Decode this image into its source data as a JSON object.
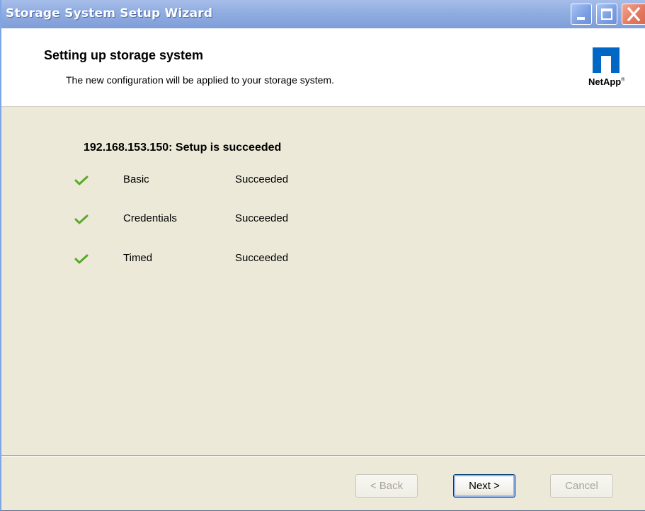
{
  "window": {
    "title": "Storage System Setup Wizard"
  },
  "header": {
    "title": "Setting up storage system",
    "subtitle": "The new configuration will be applied to your storage system.",
    "logo_text": "NetApp",
    "logo_trademark": "®"
  },
  "content": {
    "status_title": "192.168.153.150: Setup is succeeded",
    "tasks": [
      {
        "icon": "check-icon",
        "name": "Basic",
        "status": "Succeeded"
      },
      {
        "icon": "check-icon",
        "name": "Credentials",
        "status": "Succeeded"
      },
      {
        "icon": "check-icon",
        "name": "Timed",
        "status": "Succeeded"
      }
    ]
  },
  "footer": {
    "back_label": "< Back",
    "next_label": "Next >",
    "cancel_label": "Cancel"
  },
  "colors": {
    "titlebar": "#8aa7de",
    "body_background": "#ece9d8",
    "check_green": "#5aa828",
    "close_button": "#e3785e"
  }
}
